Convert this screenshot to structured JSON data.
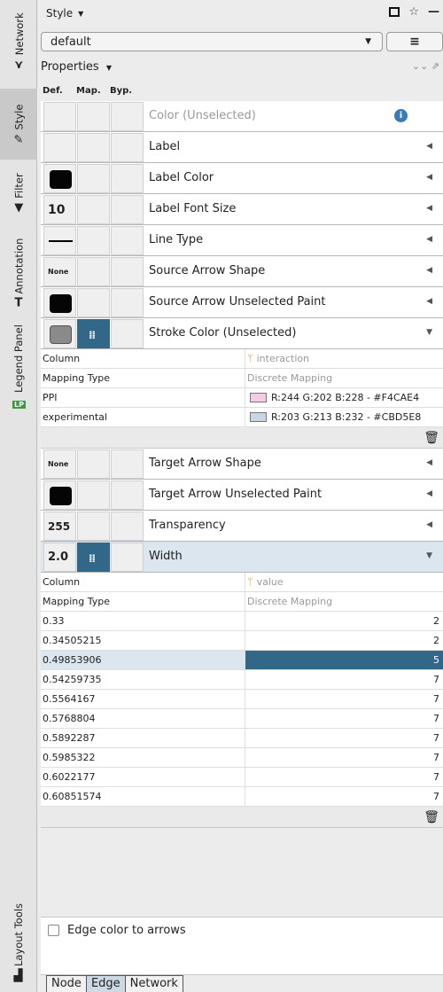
{
  "vtabs": [
    {
      "label": "Network",
      "icon": "network-icon",
      "glyph": "⋎"
    },
    {
      "label": "Style",
      "icon": "brush-icon",
      "glyph": "✎"
    },
    {
      "label": "Filter",
      "icon": "filter-icon",
      "glyph": "▼"
    },
    {
      "label": "Annotation",
      "icon": "annotation-icon",
      "glyph": "T"
    },
    {
      "label": "Legend Panel",
      "icon": "legend-icon",
      "glyph": "LP"
    },
    {
      "label": "Layout Tools",
      "icon": "layout-icon",
      "glyph": "▟"
    }
  ],
  "titlebar": {
    "title": "Style"
  },
  "style_combo": {
    "value": "default"
  },
  "properties_label": "Properties",
  "columns": {
    "def": "Def.",
    "map": "Map.",
    "byp": "Byp."
  },
  "properties": {
    "color_unselected": "Color (Unselected)",
    "label": "Label",
    "label_color": "Label Color",
    "label_font_size": {
      "label": "Label Font Size",
      "value": "10"
    },
    "line_type": "Line Type",
    "source_arrow_shape": {
      "label": "Source Arrow Shape",
      "value": "None"
    },
    "source_arrow_paint": "Source Arrow Unselected Paint",
    "stroke_color": "Stroke Color (Unselected)",
    "target_arrow_shape": {
      "label": "Target Arrow Shape",
      "value": "None"
    },
    "target_arrow_paint": "Target Arrow Unselected Paint",
    "transparency": {
      "label": "Transparency",
      "value": "255"
    },
    "width": {
      "label": "Width",
      "value": "2.0"
    }
  },
  "stroke_mapping": {
    "column_label": "Column",
    "column_value": "interaction",
    "type_label": "Mapping Type",
    "type_value": "Discrete Mapping",
    "entries": [
      {
        "key": "PPI",
        "value": "R:244 G:202 B:228 - #F4CAE4",
        "color": "#F4CAE4"
      },
      {
        "key": "experimental",
        "value": "R:203 G:213 B:232 - #CBD5E8",
        "color": "#CBD5E8"
      }
    ]
  },
  "width_mapping": {
    "column_label": "Column",
    "column_value": "value",
    "type_label": "Mapping Type",
    "type_value": "Discrete Mapping",
    "entries": [
      {
        "key": "0.33",
        "value": "2"
      },
      {
        "key": "0.34505215",
        "value": "2"
      },
      {
        "key": "0.49853906",
        "value": "5"
      },
      {
        "key": "0.54259735",
        "value": "7"
      },
      {
        "key": "0.5564167",
        "value": "7"
      },
      {
        "key": "0.5768804",
        "value": "7"
      },
      {
        "key": "0.5892287",
        "value": "7"
      },
      {
        "key": "0.5985322",
        "value": "7"
      },
      {
        "key": "0.6022177",
        "value": "7"
      },
      {
        "key": "0.60851574",
        "value": "7"
      }
    ]
  },
  "edge_color_to_arrows": "Edge color to arrows",
  "bottom_tabs": [
    "Node",
    "Edge",
    "Network"
  ]
}
